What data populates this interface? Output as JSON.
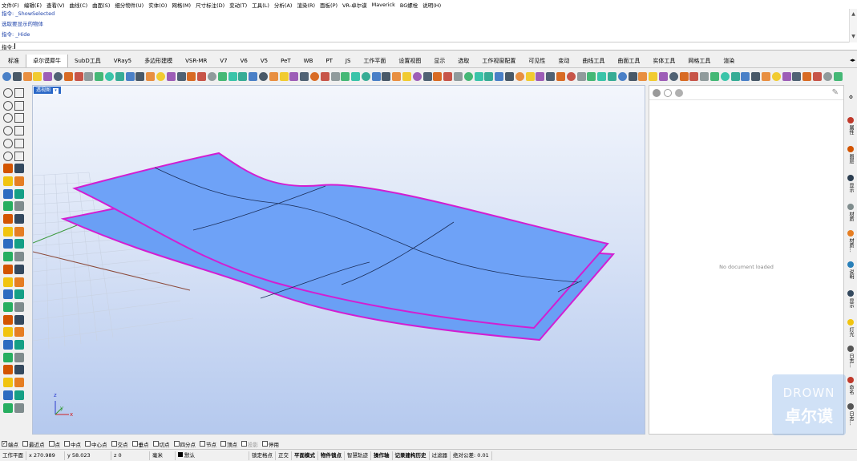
{
  "menu": [
    "文件(F)",
    "编辑(E)",
    "查看(V)",
    "曲线(C)",
    "曲面(S)",
    "细分物件(U)",
    "实体(O)",
    "网格(M)",
    "尺寸标注(D)",
    "变动(T)",
    "工具(L)",
    "分析(A)",
    "渲染(R)",
    "面板(P)",
    "VR-卓尔谟",
    "Maverick",
    "BG螺栓",
    "说明(H)"
  ],
  "command_history": [
    "指令: _ShowSelected",
    "选取要显示的物体",
    "指令: _Hide"
  ],
  "command_prompt": "指令:",
  "tabs": [
    "标准",
    "卓尔谟犀牛",
    "SubD工具",
    "VRay5",
    "多边形建模",
    "VSR-MR",
    "V7",
    "V6",
    "V5",
    "PeT",
    "WB",
    "PT",
    "JS",
    "工作平面",
    "设置视图",
    "显示",
    "选取",
    "工作视窗配置",
    "可见性",
    "变动",
    "曲线工具",
    "曲面工具",
    "实体工具",
    "网格工具",
    "渲染"
  ],
  "active_tab": "卓尔谟犀牛",
  "viewport": {
    "title": "透视图",
    "axis_x": "x",
    "axis_y": "y",
    "axis_z": "z"
  },
  "panel": {
    "message": "No document loaded"
  },
  "side_tabs": [
    {
      "label": "属性",
      "color": "#c0392b"
    },
    {
      "label": "图层",
      "color": "#d35400"
    },
    {
      "label": "显示",
      "color": "#2c3e50"
    },
    {
      "label": "材质",
      "color": "#7f8c8d"
    },
    {
      "label": "材质...",
      "color": "#e67e22"
    },
    {
      "label": "说明",
      "color": "#2980b9"
    },
    {
      "label": "显示",
      "color": "#34495e"
    },
    {
      "label": "灯光",
      "color": "#f1c40f"
    },
    {
      "label": "日志...",
      "color": "#555555"
    },
    {
      "label": "命名",
      "color": "#c0392b"
    },
    {
      "label": "日志...",
      "color": "#555555"
    }
  ],
  "osnaps": [
    {
      "label": "端点",
      "checked": true
    },
    {
      "label": "最近点",
      "checked": false
    },
    {
      "label": "点",
      "checked": false
    },
    {
      "label": "中点",
      "checked": false
    },
    {
      "label": "中心点",
      "checked": false
    },
    {
      "label": "交点",
      "checked": false
    },
    {
      "label": "垂点",
      "checked": false
    },
    {
      "label": "切点",
      "checked": false
    },
    {
      "label": "四分点",
      "checked": false
    },
    {
      "label": "节点",
      "checked": false
    },
    {
      "label": "顶点",
      "checked": false
    },
    {
      "label": "投影",
      "checked": false,
      "disabled": true
    },
    {
      "label": "停用",
      "checked": false
    }
  ],
  "status": {
    "cplane": "工作平面",
    "x": "x 270.989",
    "y": "y 58.023",
    "z": "z 0",
    "units": "毫米",
    "layer": "默认",
    "toggles": [
      "锁定格点",
      "正交",
      "平面模式",
      "物件锁点",
      "智慧轨迹",
      "操作轴",
      "记录建构历史",
      "过滤器"
    ],
    "bold_toggles": [
      "平面模式",
      "物件锁点",
      "操作轴",
      "记录建构历史"
    ],
    "tolerance": "绝对公差: 0.01"
  },
  "watermark": {
    "line1": "DROWN",
    "line2": "卓尔谟"
  },
  "colors": {
    "surface_fill": "#6a9ff5",
    "surface_edge": "#d21ed2",
    "accent": "#2a67c7"
  }
}
